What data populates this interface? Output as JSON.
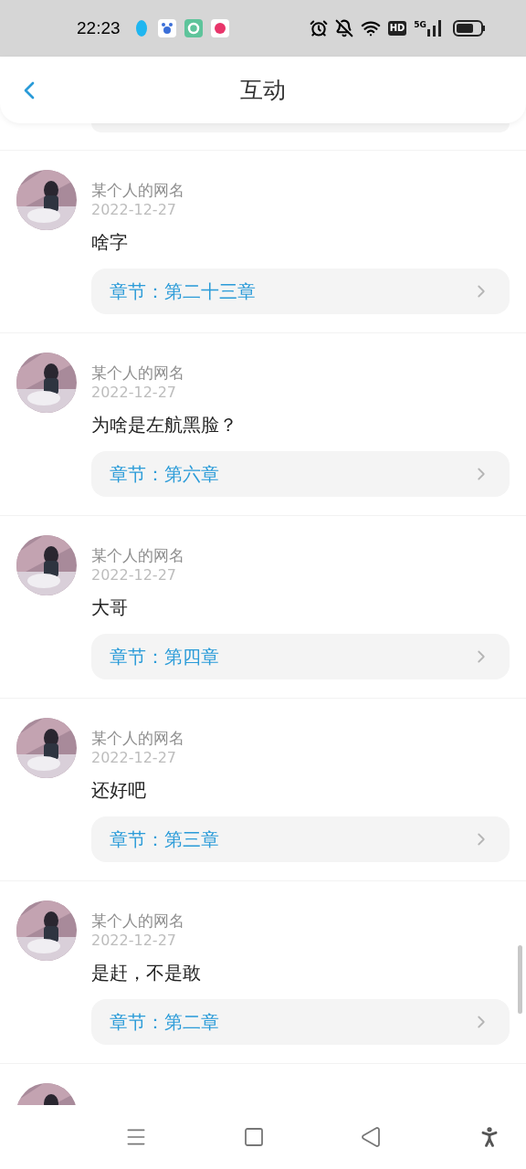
{
  "status_bar": {
    "time": "22:23",
    "hd": "HD",
    "network": "5G"
  },
  "header": {
    "title": "互动"
  },
  "comments": [
    {
      "user": "某个人的网名",
      "date": "2022-12-27",
      "text": "啥字",
      "chapter": "章节：第二十三章"
    },
    {
      "user": "某个人的网名",
      "date": "2022-12-27",
      "text": "为啥是左航黑脸？",
      "chapter": "章节：第六章"
    },
    {
      "user": "某个人的网名",
      "date": "2022-12-27",
      "text": "大哥",
      "chapter": "章节：第四章"
    },
    {
      "user": "某个人的网名",
      "date": "2022-12-27",
      "text": "还好吧",
      "chapter": "章节：第三章"
    },
    {
      "user": "某个人的网名",
      "date": "2022-12-27",
      "text": "是赶，不是敢",
      "chapter": "章节：第二章"
    }
  ]
}
